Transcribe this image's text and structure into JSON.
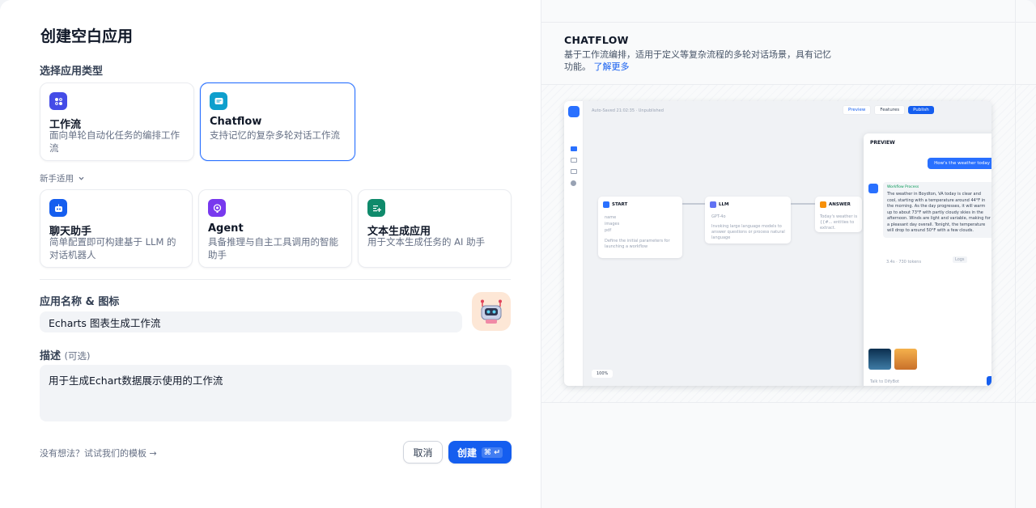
{
  "modal": {
    "title": "创建空白应用",
    "type_label": "选择应用类型",
    "cards": [
      {
        "title": "工作流",
        "desc": "面向单轮自动化任务的编排工作流",
        "icon": "workflow-icon",
        "color": "#444ce7"
      },
      {
        "title": "Chatflow",
        "desc": "支持记忆的复杂多轮对话工作流",
        "icon": "chatflow-icon",
        "color": "#0e9fcd"
      }
    ],
    "beginner_label": "新手适用",
    "beginner_cards": [
      {
        "title": "聊天助手",
        "desc": "简单配置即可构建基于 LLM 的对话机器人",
        "icon": "chat-bot-icon",
        "color": "#155eef"
      },
      {
        "title": "Agent",
        "desc": "具备推理与自主工具调用的智能助手",
        "icon": "agent-icon",
        "color": "#7839ee"
      },
      {
        "title": "文本生成应用",
        "desc": "用于文本生成任务的 AI 助手",
        "icon": "text-gen-icon",
        "color": "#0f8a6b"
      }
    ],
    "name_label": "应用名称 & 图标",
    "name_value": "Echarts 图表生成工作流",
    "desc_label": "描述",
    "desc_optional": "(可选)",
    "desc_value": "用于生成Echart数据展示使用的工作流",
    "hint": "没有想法？试试我们的模板 →",
    "cancel": "取消",
    "create": "创建",
    "create_kbd": "⌘ ↵"
  },
  "preview": {
    "title": "CHATFLOW",
    "desc": "基于工作流编排，适用于定义等复杂流程的多轮对话场景，具有记忆功能。",
    "more": "了解更多",
    "shot": {
      "status": "Auto-Saved 21:02:35 · Unpublished",
      "preview_btn": "Preview",
      "features_btn": "Features",
      "publish_btn": "Publish",
      "nodes": [
        {
          "title": "START",
          "rows": [
            "name",
            "images",
            "pdf"
          ],
          "note": "Define the initial parameters for launching a workflow"
        },
        {
          "title": "LLM",
          "rows": [
            "GPT-4o"
          ],
          "note": "Invoking large language models to answer questions or process natural language"
        },
        {
          "title": "ANSWER",
          "rows": [
            "ANSWER"
          ],
          "note": "Today's weather is {{#... entities to extract."
        }
      ],
      "zoom": "100%",
      "panel_title": "PREVIEW",
      "user_msg": "How's the weather today",
      "process_label": "Workflow Process",
      "bot_msg": "The weather in Boydton, VA today is clear and cool, starting with a temperature around 44°F in the morning. As the day progresses, it will warm up to about 73°F with partly cloudy skies in the afternoon. Winds are light and variable, making for a pleasant day overall. Tonight, the temperature will drop to around 50°F with a few clouds.",
      "meta": "3.4s · 730 tokens",
      "logs": "Logs",
      "input_placeholder": "Talk to DifyBot"
    }
  }
}
